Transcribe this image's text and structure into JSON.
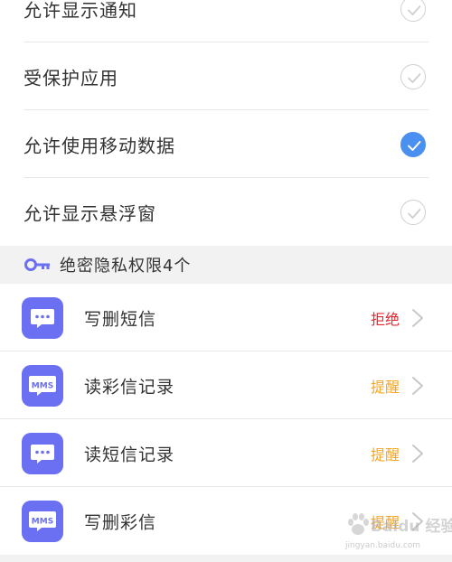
{
  "permissions": [
    {
      "label": "允许显示通知",
      "checked": false
    },
    {
      "label": "受保护应用",
      "checked": false
    },
    {
      "label": "允许使用移动数据",
      "checked": true
    },
    {
      "label": "允许显示悬浮窗",
      "checked": false
    }
  ],
  "privacy_section": {
    "icon": "key-icon",
    "title": "绝密隐私权限4个"
  },
  "privacy_items": [
    {
      "label": "写删短信",
      "status": "拒绝",
      "status_color": "#e8242c",
      "icon": "sms-icon"
    },
    {
      "label": "读彩信记录",
      "status": "提醒",
      "status_color": "#f5a623",
      "icon": "mms-icon",
      "icon_text": "MMS"
    },
    {
      "label": "读短信记录",
      "status": "提醒",
      "status_color": "#f5a623",
      "icon": "sms-icon"
    },
    {
      "label": "写删彩信",
      "status": "提醒",
      "status_color": "#f5a623",
      "icon": "mms-icon",
      "icon_text": "MMS"
    }
  ],
  "colors": {
    "accent": "#4a90f0",
    "app_icon_bg": "#6b6ff2",
    "header_bg": "#f2f2f2"
  },
  "watermark": {
    "text": "Baidu 经验",
    "url": "jingyan.baidu.com"
  }
}
